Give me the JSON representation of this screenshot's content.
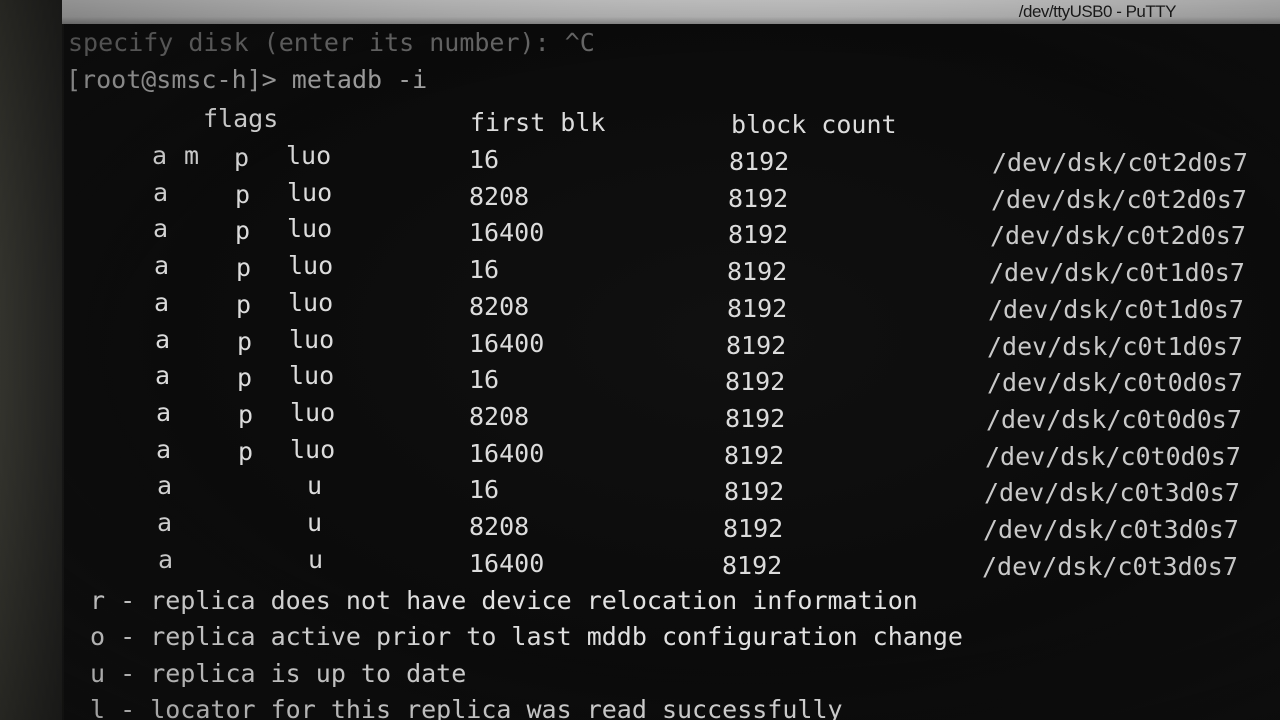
{
  "window": {
    "title": "/dev/ttyUSB0 - PuTTY"
  },
  "terminal": {
    "prompt_lines": [
      "specify disk (enter its number): ^C",
      "[root@smsc-h]> metadb -i"
    ],
    "table": {
      "headers": {
        "flags": "flags",
        "first_blk": "first blk",
        "block_count": "block count"
      },
      "rows": [
        {
          "a": "a",
          "m": "m",
          "p": "p",
          "flags_tail": "luo",
          "first": "16",
          "count": "8192",
          "device": "/dev/dsk/c0t2d0s7"
        },
        {
          "a": "a",
          "m": "",
          "p": "p",
          "flags_tail": "luo",
          "first": "8208",
          "count": "8192",
          "device": "/dev/dsk/c0t2d0s7"
        },
        {
          "a": "a",
          "m": "",
          "p": "p",
          "flags_tail": "luo",
          "first": "16400",
          "count": "8192",
          "device": "/dev/dsk/c0t2d0s7"
        },
        {
          "a": "a",
          "m": "",
          "p": "p",
          "flags_tail": "luo",
          "first": "16",
          "count": "8192",
          "device": "/dev/dsk/c0t1d0s7"
        },
        {
          "a": "a",
          "m": "",
          "p": "p",
          "flags_tail": "luo",
          "first": "8208",
          "count": "8192",
          "device": "/dev/dsk/c0t1d0s7"
        },
        {
          "a": "a",
          "m": "",
          "p": "p",
          "flags_tail": "luo",
          "first": "16400",
          "count": "8192",
          "device": "/dev/dsk/c0t1d0s7"
        },
        {
          "a": "a",
          "m": "",
          "p": "p",
          "flags_tail": "luo",
          "first": "16",
          "count": "8192",
          "device": "/dev/dsk/c0t0d0s7"
        },
        {
          "a": "a",
          "m": "",
          "p": "p",
          "flags_tail": "luo",
          "first": "8208",
          "count": "8192",
          "device": "/dev/dsk/c0t0d0s7"
        },
        {
          "a": "a",
          "m": "",
          "p": "p",
          "flags_tail": "luo",
          "first": "16400",
          "count": "8192",
          "device": "/dev/dsk/c0t0d0s7"
        },
        {
          "a": "a",
          "m": "",
          "p": "",
          "flags_tail": "u",
          "first": "16",
          "count": "8192",
          "device": "/dev/dsk/c0t3d0s7"
        },
        {
          "a": "a",
          "m": "",
          "p": "",
          "flags_tail": "u",
          "first": "8208",
          "count": "8192",
          "device": "/dev/dsk/c0t3d0s7"
        },
        {
          "a": "a",
          "m": "",
          "p": "",
          "flags_tail": "u",
          "first": "16400",
          "count": "8192",
          "device": "/dev/dsk/c0t3d0s7"
        }
      ]
    },
    "legend": [
      "r - replica does not have device relocation information",
      "o - replica active prior to last mddb configuration change",
      "u - replica is up to date",
      "l - locator for this replica was read successfully"
    ]
  }
}
